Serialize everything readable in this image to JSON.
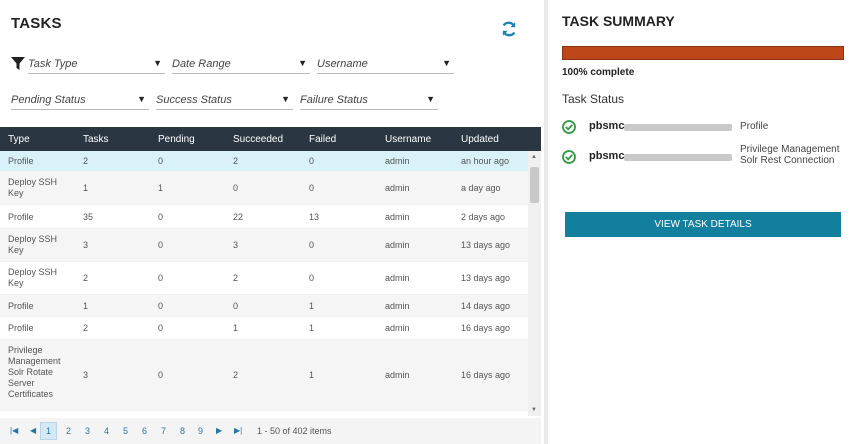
{
  "tasks_panel": {
    "title": "TASKS",
    "filters": {
      "task_type": "Task Type",
      "date_range": "Date Range",
      "username": "Username",
      "pending_status": "Pending Status",
      "success_status": "Success Status",
      "failure_status": "Failure Status"
    },
    "columns": [
      "Type",
      "Tasks",
      "Pending",
      "Succeeded",
      "Failed",
      "Username",
      "Updated"
    ],
    "rows": [
      {
        "type": "Profile",
        "tasks": "2",
        "pending": "0",
        "succeeded": "2",
        "failed": "0",
        "username": "admin",
        "updated": "an hour ago"
      },
      {
        "type": "Deploy SSH Key",
        "tasks": "1",
        "pending": "1",
        "succeeded": "0",
        "failed": "0",
        "username": "admin",
        "updated": "a day ago"
      },
      {
        "type": "Profile",
        "tasks": "35",
        "pending": "0",
        "succeeded": "22",
        "failed": "13",
        "username": "admin",
        "updated": "2 days ago"
      },
      {
        "type": "Deploy SSH Key",
        "tasks": "3",
        "pending": "0",
        "succeeded": "3",
        "failed": "0",
        "username": "admin",
        "updated": "13 days ago"
      },
      {
        "type": "Deploy SSH Key",
        "tasks": "2",
        "pending": "0",
        "succeeded": "2",
        "failed": "0",
        "username": "admin",
        "updated": "13 days ago"
      },
      {
        "type": "Profile",
        "tasks": "1",
        "pending": "0",
        "succeeded": "0",
        "failed": "1",
        "username": "admin",
        "updated": "14 days ago"
      },
      {
        "type": "Profile",
        "tasks": "2",
        "pending": "0",
        "succeeded": "1",
        "failed": "1",
        "username": "admin",
        "updated": "16 days ago"
      },
      {
        "type": "Privilege Management Solr Rotate Server Certificates",
        "tasks": "3",
        "pending": "0",
        "succeeded": "2",
        "failed": "1",
        "username": "admin",
        "updated": "16 days ago"
      }
    ],
    "pager": {
      "pages": [
        "1",
        "2",
        "3",
        "4",
        "5",
        "6",
        "7",
        "8",
        "9"
      ],
      "current": "1",
      "info": "1 - 50 of 402 items"
    }
  },
  "summary_panel": {
    "title": "TASK SUMMARY",
    "progress": 1.0,
    "progress_label": "100% complete",
    "status_label": "Task Status",
    "tasks": [
      {
        "name": "pbsmc-",
        "type": "Profile"
      },
      {
        "name": "pbsmc-",
        "type": "Privilege Management Solr Rest Connection"
      }
    ],
    "view_button": "VIEW TASK DETAILS"
  },
  "colors": {
    "header_bg": "#2a3743",
    "progress": "#bc4617",
    "button": "#137f9f",
    "check": "#2e9a3e",
    "refresh": "#1a85b3"
  },
  "icons": [
    "refresh-icon",
    "filter-icon",
    "chevron-down-icon",
    "check-circle-icon"
  ]
}
